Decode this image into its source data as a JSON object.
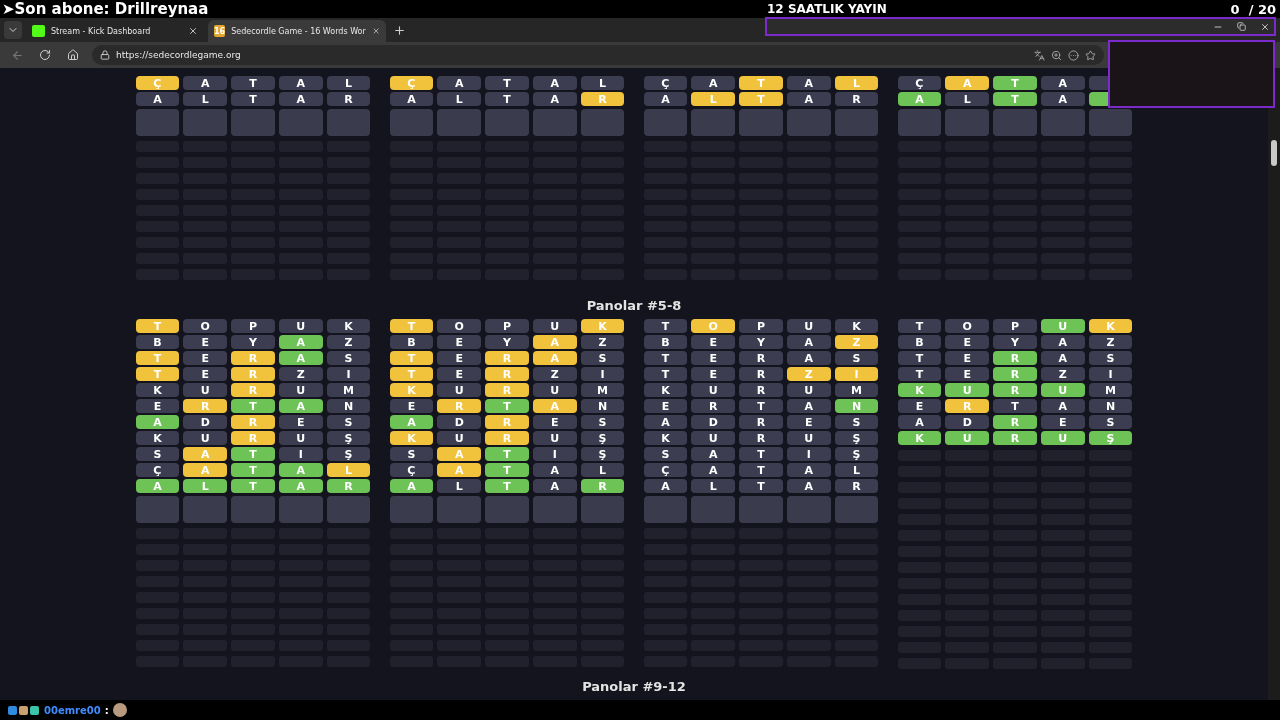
{
  "stream_overlay": {
    "last_subscriber": "➤Son abone: Drillreynaa",
    "title": "12 SAATLIK YAYIN",
    "goal_counter": "0  / 20"
  },
  "browser": {
    "tabs": [
      {
        "title": "Stream - Kick Dashboard",
        "kind": "kick",
        "selected": false
      },
      {
        "title": "Sedecordle Game - 16 Words Wor",
        "kind": "game",
        "favicon_text": "16",
        "selected": true
      }
    ],
    "url": "https://sedecordlegame.org"
  },
  "top_section": {
    "boards": [
      {
        "solved": false,
        "rows": [
          {
            "tiles": [
              {
                "letter": "Ç",
                "color": "#f1c23b"
              },
              {
                "letter": "A",
                "color": "#3c3d51"
              },
              {
                "letter": "T",
                "color": "#3c3d51"
              },
              {
                "letter": "A",
                "color": "#3c3d51"
              },
              {
                "letter": "L",
                "color": "#3c3d51"
              }
            ]
          },
          {
            "tiles": [
              {
                "letter": "A",
                "color": "#3c3d51"
              },
              {
                "letter": "L",
                "color": "#3c3d51"
              },
              {
                "letter": "T",
                "color": "#3c3d51"
              },
              {
                "letter": "A",
                "color": "#3c3d51"
              },
              {
                "letter": "R",
                "color": "#3c3d51"
              }
            ]
          }
        ]
      },
      {
        "solved": false,
        "rows": [
          {
            "tiles": [
              {
                "letter": "Ç",
                "color": "#f1c23b"
              },
              {
                "letter": "A",
                "color": "#3c3d51"
              },
              {
                "letter": "T",
                "color": "#3c3d51"
              },
              {
                "letter": "A",
                "color": "#3c3d51"
              },
              {
                "letter": "L",
                "color": "#3c3d51"
              }
            ]
          },
          {
            "tiles": [
              {
                "letter": "A",
                "color": "#3c3d51"
              },
              {
                "letter": "L",
                "color": "#3c3d51"
              },
              {
                "letter": "T",
                "color": "#3c3d51"
              },
              {
                "letter": "A",
                "color": "#3c3d51"
              },
              {
                "letter": "R",
                "color": "#f1c23b"
              }
            ]
          }
        ]
      },
      {
        "solved": false,
        "rows": [
          {
            "tiles": [
              {
                "letter": "Ç",
                "color": "#3c3d51"
              },
              {
                "letter": "A",
                "color": "#3c3d51"
              },
              {
                "letter": "T",
                "color": "#f1c23b"
              },
              {
                "letter": "A",
                "color": "#3c3d51"
              },
              {
                "letter": "L",
                "color": "#f1c23b"
              }
            ]
          },
          {
            "tiles": [
              {
                "letter": "A",
                "color": "#3c3d51"
              },
              {
                "letter": "L",
                "color": "#f1c23b"
              },
              {
                "letter": "T",
                "color": "#f1c23b"
              },
              {
                "letter": "A",
                "color": "#3c3d51"
              },
              {
                "letter": "R",
                "color": "#3c3d51"
              }
            ]
          }
        ]
      },
      {
        "solved": false,
        "rows": [
          {
            "tiles": [
              {
                "letter": "Ç",
                "color": "#3c3d51"
              },
              {
                "letter": "A",
                "color": "#f1c23b"
              },
              {
                "letter": "T",
                "color": "#6dc356"
              },
              {
                "letter": "A",
                "color": "#3c3d51"
              },
              {
                "color": "#3c3d51"
              }
            ]
          },
          {
            "tiles": [
              {
                "letter": "A",
                "color": "#6dc356"
              },
              {
                "letter": "L",
                "color": "#3c3d51"
              },
              {
                "letter": "T",
                "color": "#6dc356"
              },
              {
                "letter": "A",
                "color": "#3c3d51"
              },
              {
                "color": "#6dc356"
              }
            ]
          }
        ]
      }
    ]
  },
  "sections": [
    {
      "heading": "Panolar #5-8",
      "boards": [
        {
          "solved": false,
          "rows": [
            {
              "tiles": [
                {
                  "letter": "T",
                  "color": "#f1c23b"
                },
                {
                  "letter": "O",
                  "color": "#3c3d51"
                },
                {
                  "letter": "P",
                  "color": "#3c3d51"
                },
                {
                  "letter": "U",
                  "color": "#3c3d51"
                },
                {
                  "letter": "K",
                  "color": "#3c3d51"
                }
              ]
            },
            {
              "tiles": [
                {
                  "letter": "B",
                  "color": "#3c3d51"
                },
                {
                  "letter": "E",
                  "color": "#3c3d51"
                },
                {
                  "letter": "Y",
                  "color": "#3c3d51"
                },
                {
                  "letter": "A",
                  "color": "#6dc356"
                },
                {
                  "letter": "Z",
                  "color": "#3c3d51"
                }
              ]
            },
            {
              "tiles": [
                {
                  "letter": "T",
                  "color": "#f1c23b"
                },
                {
                  "letter": "E",
                  "color": "#3c3d51"
                },
                {
                  "letter": "R",
                  "color": "#f1c23b"
                },
                {
                  "letter": "A",
                  "color": "#6dc356"
                },
                {
                  "letter": "S",
                  "color": "#3c3d51"
                }
              ]
            },
            {
              "tiles": [
                {
                  "letter": "T",
                  "color": "#f1c23b"
                },
                {
                  "letter": "E",
                  "color": "#3c3d51"
                },
                {
                  "letter": "R",
                  "color": "#f1c23b"
                },
                {
                  "letter": "Z",
                  "color": "#3c3d51"
                },
                {
                  "letter": "I",
                  "color": "#3c3d51"
                }
              ]
            },
            {
              "tiles": [
                {
                  "letter": "K",
                  "color": "#3c3d51"
                },
                {
                  "letter": "U",
                  "color": "#3c3d51"
                },
                {
                  "letter": "R",
                  "color": "#f1c23b"
                },
                {
                  "letter": "U",
                  "color": "#3c3d51"
                },
                {
                  "letter": "M",
                  "color": "#3c3d51"
                }
              ]
            },
            {
              "tiles": [
                {
                  "letter": "E",
                  "color": "#3c3d51"
                },
                {
                  "letter": "R",
                  "color": "#f1c23b"
                },
                {
                  "letter": "T",
                  "color": "#6dc356"
                },
                {
                  "letter": "A",
                  "color": "#6dc356"
                },
                {
                  "letter": "N",
                  "color": "#3c3d51"
                }
              ]
            },
            {
              "tiles": [
                {
                  "letter": "A",
                  "color": "#6dc356"
                },
                {
                  "letter": "D",
                  "color": "#3c3d51"
                },
                {
                  "letter": "R",
                  "color": "#f1c23b"
                },
                {
                  "letter": "E",
                  "color": "#3c3d51"
                },
                {
                  "letter": "S",
                  "color": "#3c3d51"
                }
              ]
            },
            {
              "tiles": [
                {
                  "letter": "K",
                  "color": "#3c3d51"
                },
                {
                  "letter": "U",
                  "color": "#3c3d51"
                },
                {
                  "letter": "R",
                  "color": "#f1c23b"
                },
                {
                  "letter": "U",
                  "color": "#3c3d51"
                },
                {
                  "letter": "Ş",
                  "color": "#3c3d51"
                }
              ]
            },
            {
              "tiles": [
                {
                  "letter": "S",
                  "color": "#3c3d51"
                },
                {
                  "letter": "A",
                  "color": "#f1c23b"
                },
                {
                  "letter": "T",
                  "color": "#6dc356"
                },
                {
                  "letter": "I",
                  "color": "#3c3d51"
                },
                {
                  "letter": "Ş",
                  "color": "#3c3d51"
                }
              ]
            },
            {
              "tiles": [
                {
                  "letter": "Ç",
                  "color": "#3c3d51"
                },
                {
                  "letter": "A",
                  "color": "#f1c23b"
                },
                {
                  "letter": "T",
                  "color": "#6dc356"
                },
                {
                  "letter": "A",
                  "color": "#6dc356"
                },
                {
                  "letter": "L",
                  "color": "#f1c23b"
                }
              ]
            },
            {
              "tiles": [
                {
                  "letter": "A",
                  "color": "#6dc356"
                },
                {
                  "letter": "L",
                  "color": "#6dc356"
                },
                {
                  "letter": "T",
                  "color": "#6dc356"
                },
                {
                  "letter": "A",
                  "color": "#6dc356"
                },
                {
                  "letter": "R",
                  "color": "#6dc356"
                }
              ]
            }
          ]
        },
        {
          "solved": false,
          "rows": [
            {
              "tiles": [
                {
                  "letter": "T",
                  "color": "#f1c23b"
                },
                {
                  "letter": "O",
                  "color": "#3c3d51"
                },
                {
                  "letter": "P",
                  "color": "#3c3d51"
                },
                {
                  "letter": "U",
                  "color": "#3c3d51"
                },
                {
                  "letter": "K",
                  "color": "#f1c23b"
                }
              ]
            },
            {
              "tiles": [
                {
                  "letter": "B",
                  "color": "#3c3d51"
                },
                {
                  "letter": "E",
                  "color": "#3c3d51"
                },
                {
                  "letter": "Y",
                  "color": "#3c3d51"
                },
                {
                  "letter": "A",
                  "color": "#f1c23b"
                },
                {
                  "letter": "Z",
                  "color": "#3c3d51"
                }
              ]
            },
            {
              "tiles": [
                {
                  "letter": "T",
                  "color": "#f1c23b"
                },
                {
                  "letter": "E",
                  "color": "#3c3d51"
                },
                {
                  "letter": "R",
                  "color": "#f1c23b"
                },
                {
                  "letter": "A",
                  "color": "#f1c23b"
                },
                {
                  "letter": "S",
                  "color": "#3c3d51"
                }
              ]
            },
            {
              "tiles": [
                {
                  "letter": "T",
                  "color": "#f1c23b"
                },
                {
                  "letter": "E",
                  "color": "#3c3d51"
                },
                {
                  "letter": "R",
                  "color": "#f1c23b"
                },
                {
                  "letter": "Z",
                  "color": "#3c3d51"
                },
                {
                  "letter": "I",
                  "color": "#3c3d51"
                }
              ]
            },
            {
              "tiles": [
                {
                  "letter": "K",
                  "color": "#f1c23b"
                },
                {
                  "letter": "U",
                  "color": "#3c3d51"
                },
                {
                  "letter": "R",
                  "color": "#f1c23b"
                },
                {
                  "letter": "U",
                  "color": "#3c3d51"
                },
                {
                  "letter": "M",
                  "color": "#3c3d51"
                }
              ]
            },
            {
              "tiles": [
                {
                  "letter": "E",
                  "color": "#3c3d51"
                },
                {
                  "letter": "R",
                  "color": "#f1c23b"
                },
                {
                  "letter": "T",
                  "color": "#6dc356"
                },
                {
                  "letter": "A",
                  "color": "#f1c23b"
                },
                {
                  "letter": "N",
                  "color": "#3c3d51"
                }
              ]
            },
            {
              "tiles": [
                {
                  "letter": "A",
                  "color": "#6dc356"
                },
                {
                  "letter": "D",
                  "color": "#3c3d51"
                },
                {
                  "letter": "R",
                  "color": "#f1c23b"
                },
                {
                  "letter": "E",
                  "color": "#3c3d51"
                },
                {
                  "letter": "S",
                  "color": "#3c3d51"
                }
              ]
            },
            {
              "tiles": [
                {
                  "letter": "K",
                  "color": "#f1c23b"
                },
                {
                  "letter": "U",
                  "color": "#3c3d51"
                },
                {
                  "letter": "R",
                  "color": "#f1c23b"
                },
                {
                  "letter": "U",
                  "color": "#3c3d51"
                },
                {
                  "letter": "Ş",
                  "color": "#3c3d51"
                }
              ]
            },
            {
              "tiles": [
                {
                  "letter": "S",
                  "color": "#3c3d51"
                },
                {
                  "letter": "A",
                  "color": "#f1c23b"
                },
                {
                  "letter": "T",
                  "color": "#6dc356"
                },
                {
                  "letter": "I",
                  "color": "#3c3d51"
                },
                {
                  "letter": "Ş",
                  "color": "#3c3d51"
                }
              ]
            },
            {
              "tiles": [
                {
                  "letter": "Ç",
                  "color": "#3c3d51"
                },
                {
                  "letter": "A",
                  "color": "#f1c23b"
                },
                {
                  "letter": "T",
                  "color": "#6dc356"
                },
                {
                  "letter": "A",
                  "color": "#3c3d51"
                },
                {
                  "letter": "L",
                  "color": "#3c3d51"
                }
              ]
            },
            {
              "tiles": [
                {
                  "letter": "A",
                  "color": "#6dc356"
                },
                {
                  "letter": "L",
                  "color": "#3c3d51"
                },
                {
                  "letter": "T",
                  "color": "#6dc356"
                },
                {
                  "letter": "A",
                  "color": "#3c3d51"
                },
                {
                  "letter": "R",
                  "color": "#6dc356"
                }
              ]
            }
          ]
        },
        {
          "solved": false,
          "rows": [
            {
              "tiles": [
                {
                  "letter": "T",
                  "color": "#3c3d51"
                },
                {
                  "letter": "O",
                  "color": "#f1c23b"
                },
                {
                  "letter": "P",
                  "color": "#3c3d51"
                },
                {
                  "letter": "U",
                  "color": "#3c3d51"
                },
                {
                  "letter": "K",
                  "color": "#3c3d51"
                }
              ]
            },
            {
              "tiles": [
                {
                  "letter": "B",
                  "color": "#3c3d51"
                },
                {
                  "letter": "E",
                  "color": "#3c3d51"
                },
                {
                  "letter": "Y",
                  "color": "#3c3d51"
                },
                {
                  "letter": "A",
                  "color": "#3c3d51"
                },
                {
                  "letter": "Z",
                  "color": "#f1c23b"
                }
              ]
            },
            {
              "tiles": [
                {
                  "letter": "T",
                  "color": "#3c3d51"
                },
                {
                  "letter": "E",
                  "color": "#3c3d51"
                },
                {
                  "letter": "R",
                  "color": "#3c3d51"
                },
                {
                  "letter": "A",
                  "color": "#3c3d51"
                },
                {
                  "letter": "S",
                  "color": "#3c3d51"
                }
              ]
            },
            {
              "tiles": [
                {
                  "letter": "T",
                  "color": "#3c3d51"
                },
                {
                  "letter": "E",
                  "color": "#3c3d51"
                },
                {
                  "letter": "R",
                  "color": "#3c3d51"
                },
                {
                  "letter": "Z",
                  "color": "#f1c23b"
                },
                {
                  "letter": "I",
                  "color": "#f1c23b"
                }
              ]
            },
            {
              "tiles": [
                {
                  "letter": "K",
                  "color": "#3c3d51"
                },
                {
                  "letter": "U",
                  "color": "#3c3d51"
                },
                {
                  "letter": "R",
                  "color": "#3c3d51"
                },
                {
                  "letter": "U",
                  "color": "#3c3d51"
                },
                {
                  "letter": "M",
                  "color": "#3c3d51"
                }
              ]
            },
            {
              "tiles": [
                {
                  "letter": "E",
                  "color": "#3c3d51"
                },
                {
                  "letter": "R",
                  "color": "#3c3d51"
                },
                {
                  "letter": "T",
                  "color": "#3c3d51"
                },
                {
                  "letter": "A",
                  "color": "#3c3d51"
                },
                {
                  "letter": "N",
                  "color": "#6dc356"
                }
              ]
            },
            {
              "tiles": [
                {
                  "letter": "A",
                  "color": "#3c3d51"
                },
                {
                  "letter": "D",
                  "color": "#3c3d51"
                },
                {
                  "letter": "R",
                  "color": "#3c3d51"
                },
                {
                  "letter": "E",
                  "color": "#3c3d51"
                },
                {
                  "letter": "S",
                  "color": "#3c3d51"
                }
              ]
            },
            {
              "tiles": [
                {
                  "letter": "K",
                  "color": "#3c3d51"
                },
                {
                  "letter": "U",
                  "color": "#3c3d51"
                },
                {
                  "letter": "R",
                  "color": "#3c3d51"
                },
                {
                  "letter": "U",
                  "color": "#3c3d51"
                },
                {
                  "letter": "Ş",
                  "color": "#3c3d51"
                }
              ]
            },
            {
              "tiles": [
                {
                  "letter": "S",
                  "color": "#3c3d51"
                },
                {
                  "letter": "A",
                  "color": "#3c3d51"
                },
                {
                  "letter": "T",
                  "color": "#3c3d51"
                },
                {
                  "letter": "I",
                  "color": "#3c3d51"
                },
                {
                  "letter": "Ş",
                  "color": "#3c3d51"
                }
              ]
            },
            {
              "tiles": [
                {
                  "letter": "Ç",
                  "color": "#3c3d51"
                },
                {
                  "letter": "A",
                  "color": "#3c3d51"
                },
                {
                  "letter": "T",
                  "color": "#3c3d51"
                },
                {
                  "letter": "A",
                  "color": "#3c3d51"
                },
                {
                  "letter": "L",
                  "color": "#3c3d51"
                }
              ]
            },
            {
              "tiles": [
                {
                  "letter": "A",
                  "color": "#3c3d51"
                },
                {
                  "letter": "L",
                  "color": "#3c3d51"
                },
                {
                  "letter": "T",
                  "color": "#3c3d51"
                },
                {
                  "letter": "A",
                  "color": "#3c3d51"
                },
                {
                  "letter": "R",
                  "color": "#3c3d51"
                }
              ]
            }
          ]
        },
        {
          "solved": true,
          "rows": [
            {
              "tiles": [
                {
                  "letter": "T",
                  "color": "#3c3d51"
                },
                {
                  "letter": "O",
                  "color": "#3c3d51"
                },
                {
                  "letter": "P",
                  "color": "#3c3d51"
                },
                {
                  "letter": "U",
                  "color": "#6dc356"
                },
                {
                  "letter": "K",
                  "color": "#f1c23b"
                }
              ]
            },
            {
              "tiles": [
                {
                  "letter": "B",
                  "color": "#3c3d51"
                },
                {
                  "letter": "E",
                  "color": "#3c3d51"
                },
                {
                  "letter": "Y",
                  "color": "#3c3d51"
                },
                {
                  "letter": "A",
                  "color": "#3c3d51"
                },
                {
                  "letter": "Z",
                  "color": "#3c3d51"
                }
              ]
            },
            {
              "tiles": [
                {
                  "letter": "T",
                  "color": "#3c3d51"
                },
                {
                  "letter": "E",
                  "color": "#3c3d51"
                },
                {
                  "letter": "R",
                  "color": "#6dc356"
                },
                {
                  "letter": "A",
                  "color": "#3c3d51"
                },
                {
                  "letter": "S",
                  "color": "#3c3d51"
                }
              ]
            },
            {
              "tiles": [
                {
                  "letter": "T",
                  "color": "#3c3d51"
                },
                {
                  "letter": "E",
                  "color": "#3c3d51"
                },
                {
                  "letter": "R",
                  "color": "#6dc356"
                },
                {
                  "letter": "Z",
                  "color": "#3c3d51"
                },
                {
                  "letter": "I",
                  "color": "#3c3d51"
                }
              ]
            },
            {
              "tiles": [
                {
                  "letter": "K",
                  "color": "#6dc356"
                },
                {
                  "letter": "U",
                  "color": "#6dc356"
                },
                {
                  "letter": "R",
                  "color": "#6dc356"
                },
                {
                  "letter": "U",
                  "color": "#6dc356"
                },
                {
                  "letter": "M",
                  "color": "#3c3d51"
                }
              ]
            },
            {
              "tiles": [
                {
                  "letter": "E",
                  "color": "#3c3d51"
                },
                {
                  "letter": "R",
                  "color": "#f1c23b"
                },
                {
                  "letter": "T",
                  "color": "#3c3d51"
                },
                {
                  "letter": "A",
                  "color": "#3c3d51"
                },
                {
                  "letter": "N",
                  "color": "#3c3d51"
                }
              ]
            },
            {
              "tiles": [
                {
                  "letter": "A",
                  "color": "#3c3d51"
                },
                {
                  "letter": "D",
                  "color": "#3c3d51"
                },
                {
                  "letter": "R",
                  "color": "#6dc356"
                },
                {
                  "letter": "E",
                  "color": "#3c3d51"
                },
                {
                  "letter": "S",
                  "color": "#3c3d51"
                }
              ]
            },
            {
              "tiles": [
                {
                  "letter": "K",
                  "color": "#6dc356"
                },
                {
                  "letter": "U",
                  "color": "#6dc356"
                },
                {
                  "letter": "R",
                  "color": "#6dc356"
                },
                {
                  "letter": "U",
                  "color": "#6dc356"
                },
                {
                  "letter": "Ş",
                  "color": "#6dc356"
                }
              ]
            }
          ]
        }
      ]
    },
    {
      "heading": "Panolar #9-12"
    }
  ],
  "chat": {
    "username": "00emre00",
    "separator": ":"
  }
}
